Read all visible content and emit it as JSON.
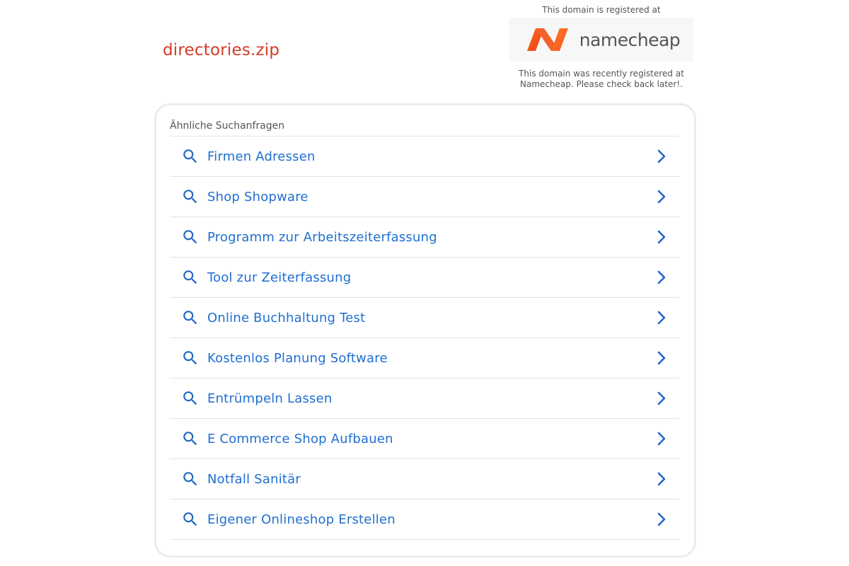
{
  "header": {
    "domain": "directories.zip"
  },
  "registrar": {
    "top_text": "This domain is registered at",
    "logo_text": "namecheap",
    "bottom_text_line1": "This domain was recently registered at",
    "bottom_text_line2": "Namecheap. Please check back later!.",
    "logo_colors": [
      "#f2542d",
      "#f77b1e"
    ]
  },
  "related": {
    "heading": "Ähnliche Suchanfragen",
    "items": [
      {
        "label": "Firmen Adressen"
      },
      {
        "label": "Shop Shopware"
      },
      {
        "label": "Programm zur Arbeitszeiterfassung"
      },
      {
        "label": "Tool zur Zeiterfassung"
      },
      {
        "label": "Online Buchhaltung Test"
      },
      {
        "label": "Kostenlos Planung Software"
      },
      {
        "label": "Entrümpeln Lassen"
      },
      {
        "label": "E Commerce Shop Aufbauen"
      },
      {
        "label": "Notfall Sanitär"
      },
      {
        "label": "Eigener Onlineshop Erstellen"
      }
    ]
  },
  "colors": {
    "domain_title": "#d33c26",
    "link": "#1f6fd0",
    "icon": "#2167c6"
  },
  "icons": {
    "item_left": "search-icon",
    "item_right": "chevron-right-icon"
  }
}
